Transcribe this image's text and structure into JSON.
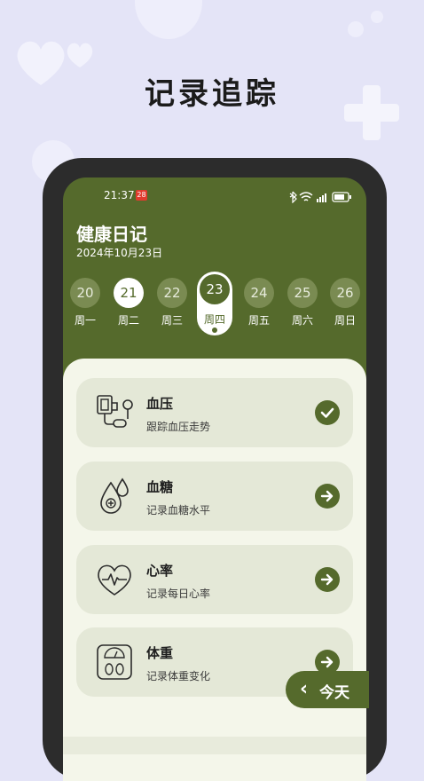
{
  "headline": "记录追踪",
  "status": {
    "time": "21:37",
    "sim_badge": "28"
  },
  "app": {
    "title": "健康日记",
    "date": "2024年10月23日"
  },
  "days": [
    {
      "num": "20",
      "weekday": "周一"
    },
    {
      "num": "21",
      "weekday": "周二"
    },
    {
      "num": "22",
      "weekday": "周三"
    },
    {
      "num": "23",
      "weekday": "周四"
    },
    {
      "num": "24",
      "weekday": "周五"
    },
    {
      "num": "25",
      "weekday": "周六"
    },
    {
      "num": "26",
      "weekday": "周日"
    }
  ],
  "cards": [
    {
      "title": "血压",
      "subtitle": "跟踪血压走势",
      "icon": "blood-pressure-icon",
      "action": "check"
    },
    {
      "title": "血糖",
      "subtitle": "记录血糖水平",
      "icon": "blood-drop-icon",
      "action": "arrow"
    },
    {
      "title": "心率",
      "subtitle": "记录每日心率",
      "icon": "heart-rate-icon",
      "action": "arrow"
    },
    {
      "title": "体重",
      "subtitle": "记录体重变化",
      "icon": "scale-icon",
      "action": "arrow"
    }
  ],
  "today_button": {
    "label": "今天",
    "chevron": "‹"
  },
  "colors": {
    "primary": "#556a2c",
    "card": "#e4e8d7",
    "panel": "#f4f6ea",
    "background": "#e4e4f7"
  }
}
